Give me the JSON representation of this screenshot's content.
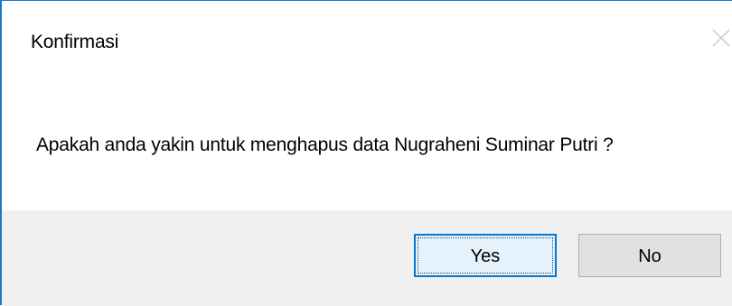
{
  "dialog": {
    "title": "Konfirmasi",
    "message": "Apakah anda yakin untuk menghapus data Nugraheni Suminar Putri ?",
    "buttons": {
      "yes_label": "Yes",
      "no_label": "No"
    },
    "close_icon": "close-icon"
  },
  "colors": {
    "border_accent": "#1979ca",
    "footer_bg": "#f0f0f0",
    "default_button_border": "#0078d7",
    "default_button_bg": "#e5f1fb",
    "button_bg": "#e1e1e1"
  }
}
